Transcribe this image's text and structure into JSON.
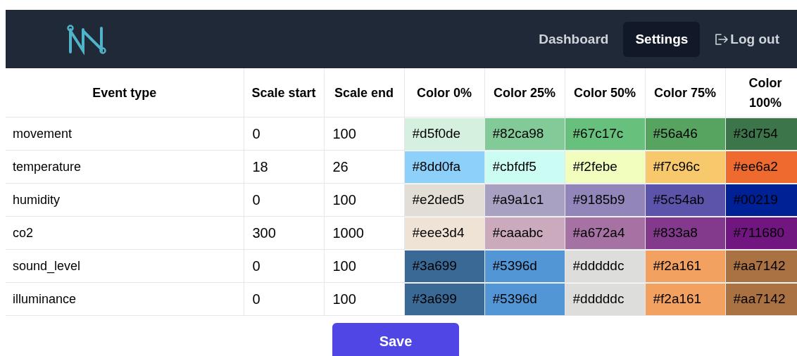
{
  "nav": {
    "items": [
      {
        "label": "Dashboard",
        "selected": false
      },
      {
        "label": "Settings",
        "selected": true
      }
    ],
    "logout": "Log out"
  },
  "table": {
    "columns": [
      "Event type",
      "Scale start",
      "Scale end",
      "Color 0%",
      "Color 25%",
      "Color 50%",
      "Color 75%",
      "Color 100%"
    ],
    "rows": [
      {
        "event_type": "movement",
        "scale_start": "0",
        "scale_end": "100",
        "colors": [
          {
            "value": "#d5f0de",
            "color": "#d5f0de"
          },
          {
            "value": "#82ca98",
            "color": "#82ca98"
          },
          {
            "value": "#67c17c",
            "color": "#67c17c"
          },
          {
            "value": "#56a46",
            "color": "#56a460"
          },
          {
            "value": "#3d754",
            "color": "#3d754b"
          }
        ]
      },
      {
        "event_type": "temperature",
        "scale_start": "18",
        "scale_end": "26",
        "colors": [
          {
            "value": "#8dd0fa",
            "color": "#8dd0fa"
          },
          {
            "value": "#cbfdf5",
            "color": "#cbfdf5"
          },
          {
            "value": "#f2febe",
            "color": "#f2febe"
          },
          {
            "value": "#f7c96c",
            "color": "#f7c96c"
          },
          {
            "value": "#ee6a2",
            "color": "#ee6a2e"
          }
        ]
      },
      {
        "event_type": "humidity",
        "scale_start": "0",
        "scale_end": "100",
        "colors": [
          {
            "value": "#e2ded5",
            "color": "#e2ded5"
          },
          {
            "value": "#a9a1c1",
            "color": "#a9a1c1"
          },
          {
            "value": "#9185b9",
            "color": "#9185b9"
          },
          {
            "value": "#5c54ab",
            "color": "#5c54ab"
          },
          {
            "value": "#00219",
            "color": "#002196"
          }
        ]
      },
      {
        "event_type": "co2",
        "scale_start": "300",
        "scale_end": "1000",
        "colors": [
          {
            "value": "#eee3d4",
            "color": "#eee3d4"
          },
          {
            "value": "#caaabc",
            "color": "#caaabc"
          },
          {
            "value": "#a672a4",
            "color": "#a672a4"
          },
          {
            "value": "#833a8",
            "color": "#833a8c"
          },
          {
            "value": "#711680",
            "color": "#711680"
          }
        ]
      },
      {
        "event_type": "sound_level",
        "scale_start": "0",
        "scale_end": "100",
        "colors": [
          {
            "value": "#3a699",
            "color": "#3a6995"
          },
          {
            "value": "#5396d",
            "color": "#5396d5"
          },
          {
            "value": "#dddddc",
            "color": "#dddddc"
          },
          {
            "value": "#f2a161",
            "color": "#f2a161"
          },
          {
            "value": "#aa7142",
            "color": "#aa7142"
          }
        ]
      },
      {
        "event_type": "illuminance",
        "scale_start": "0",
        "scale_end": "100",
        "colors": [
          {
            "value": "#3a699",
            "color": "#3a6995"
          },
          {
            "value": "#5396d",
            "color": "#5396d5"
          },
          {
            "value": "#dddddc",
            "color": "#dddddc"
          },
          {
            "value": "#f2a161",
            "color": "#f2a161"
          },
          {
            "value": "#aa7142",
            "color": "#aa7142"
          }
        ]
      }
    ]
  },
  "save_button": "Save"
}
